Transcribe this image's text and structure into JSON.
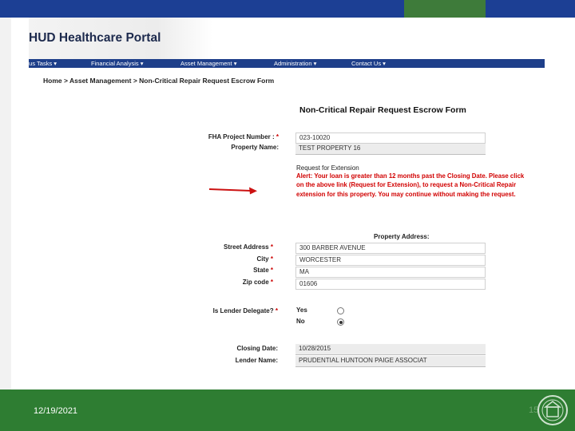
{
  "footer": {
    "date": "12/19/2021",
    "page": "15"
  },
  "portal": {
    "title": "HUD Healthcare Portal"
  },
  "nav": {
    "items": [
      {
        "label": "ous Tasks ▾"
      },
      {
        "label": "Financial Analysis ▾"
      },
      {
        "label": "Asset Management ▾"
      },
      {
        "label": "Administration ▾"
      },
      {
        "label": "Contact Us ▾"
      }
    ]
  },
  "breadcrumb": "Home > Asset Management > Non-Critical Repair Request Escrow Form",
  "form": {
    "title": "Non-Critical Repair Request Escrow Form",
    "fha_label": "FHA Project Number :",
    "fha_value": "023-10020",
    "property_name_label": "Property Name:",
    "property_name_value": "TEST PROPERTY 16",
    "extension_link": "Request for Extension",
    "alert": "Alert: Your loan is greater than 12 months past the Closing Date. Please click on the above link (Request for Extension), to request a Non-Critical Repair extension for this property. You may continue without making the request.",
    "property_address_heading": "Property Address:",
    "street_label": "Street Address",
    "street_value": "300 BARBER AVENUE",
    "city_label": "City",
    "city_value": "WORCESTER",
    "state_label": "State",
    "state_value": "MA",
    "zip_label": "Zip code",
    "zip_value": "01606",
    "lender_delegate_label": "Is Lender Delegate?",
    "lender_delegate_options": [
      {
        "label": "Yes",
        "selected": false
      },
      {
        "label": "No",
        "selected": true
      }
    ],
    "closing_date_label": "Closing Date:",
    "closing_date_value": "10/28/2015",
    "lender_name_label": "Lender Name:",
    "lender_name_value": "PRUDENTIAL HUNTOON PAIGE ASSOCIAT",
    "required_marker": "*"
  },
  "colors": {
    "nav_bar": "#1e3f8a",
    "footer": "#2e7d32",
    "alert": "#d10000",
    "arrow": "#cc1111"
  },
  "icons": {
    "arrow": "red-arrow-icon",
    "seal": "hud-seal-icon"
  }
}
